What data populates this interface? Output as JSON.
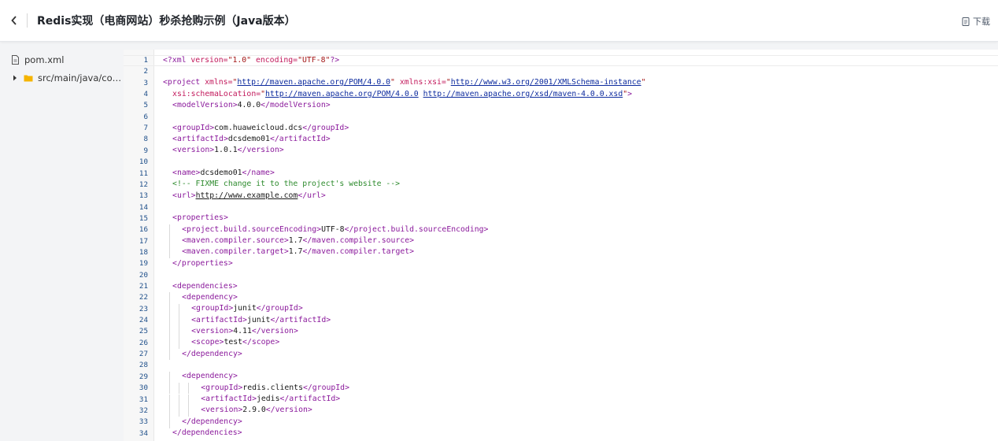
{
  "header": {
    "title": "Redis实现（电商网站）秒杀抢购示例（Java版本）",
    "download_label": "下载"
  },
  "sidebar": {
    "items": [
      {
        "label": "pom.xml",
        "icon": "file-icon"
      },
      {
        "label": "src/main/java/co…",
        "icon": "folder-icon"
      }
    ]
  },
  "colors": {
    "tag": "#8b1a9c",
    "attr_name": "#c2185b",
    "attr_value": "#a31515",
    "link": "#0d2b9e",
    "comment": "#2e8b2e",
    "line_number": "#1d4e89",
    "folder": "#f5b400"
  },
  "editor": {
    "lines": [
      {
        "n": "1",
        "indent": 0,
        "parts": [
          [
            "br",
            "<?"
          ],
          [
            "tg",
            "xml "
          ],
          [
            "an",
            "version="
          ],
          [
            "av",
            "\"1.0\""
          ],
          [
            "tx",
            " "
          ],
          [
            "an",
            "encoding="
          ],
          [
            "av",
            "\"UTF-8\""
          ],
          [
            "br",
            "?>"
          ]
        ]
      },
      {
        "n": "2",
        "indent": 0,
        "parts": []
      },
      {
        "n": "3",
        "indent": 0,
        "parts": [
          [
            "br",
            "<"
          ],
          [
            "tg",
            "project "
          ],
          [
            "an",
            "xmlns="
          ],
          [
            "av",
            "\""
          ],
          [
            "lnk",
            "http://maven.apache.org/POM/4.0.0"
          ],
          [
            "av",
            "\""
          ],
          [
            "tx",
            " "
          ],
          [
            "an",
            "xmlns:xsi="
          ],
          [
            "av",
            "\""
          ],
          [
            "lnk",
            "http://www.w3.org/2001/XMLSchema-instance"
          ],
          [
            "av",
            "\""
          ]
        ]
      },
      {
        "n": "4",
        "indent": 1,
        "parts": [
          [
            "an",
            "xsi:schemaLocation="
          ],
          [
            "av",
            "\""
          ],
          [
            "lnk",
            "http://maven.apache.org/POM/4.0.0"
          ],
          [
            "tx",
            " "
          ],
          [
            "lnk",
            "http://maven.apache.org/xsd/maven-4.0.0.xsd"
          ],
          [
            "av",
            "\""
          ],
          [
            "br",
            ">"
          ]
        ]
      },
      {
        "n": "5",
        "indent": 1,
        "parts": [
          [
            "br",
            "<"
          ],
          [
            "tg",
            "modelVersion"
          ],
          [
            "br",
            ">"
          ],
          [
            "tx",
            "4.0.0"
          ],
          [
            "br",
            "</"
          ],
          [
            "tg",
            "modelVersion"
          ],
          [
            "br",
            ">"
          ]
        ]
      },
      {
        "n": "6",
        "indent": 0,
        "parts": []
      },
      {
        "n": "7",
        "indent": 1,
        "parts": [
          [
            "br",
            "<"
          ],
          [
            "tg",
            "groupId"
          ],
          [
            "br",
            ">"
          ],
          [
            "tx",
            "com.huaweicloud.dcs"
          ],
          [
            "br",
            "</"
          ],
          [
            "tg",
            "groupId"
          ],
          [
            "br",
            ">"
          ]
        ]
      },
      {
        "n": "8",
        "indent": 1,
        "parts": [
          [
            "br",
            "<"
          ],
          [
            "tg",
            "artifactId"
          ],
          [
            "br",
            ">"
          ],
          [
            "tx",
            "dcsdemo01"
          ],
          [
            "br",
            "</"
          ],
          [
            "tg",
            "artifactId"
          ],
          [
            "br",
            ">"
          ]
        ]
      },
      {
        "n": "9",
        "indent": 1,
        "parts": [
          [
            "br",
            "<"
          ],
          [
            "tg",
            "version"
          ],
          [
            "br",
            ">"
          ],
          [
            "tx",
            "1.0.1"
          ],
          [
            "br",
            "</"
          ],
          [
            "tg",
            "version"
          ],
          [
            "br",
            ">"
          ]
        ]
      },
      {
        "n": "10",
        "indent": 0,
        "parts": []
      },
      {
        "n": "11",
        "indent": 1,
        "parts": [
          [
            "br",
            "<"
          ],
          [
            "tg",
            "name"
          ],
          [
            "br",
            ">"
          ],
          [
            "tx",
            "dcsdemo01"
          ],
          [
            "br",
            "</"
          ],
          [
            "tg",
            "name"
          ],
          [
            "br",
            ">"
          ]
        ]
      },
      {
        "n": "12",
        "indent": 1,
        "parts": [
          [
            "cm",
            "<!-- FIXME change it to the project's website -->"
          ]
        ]
      },
      {
        "n": "13",
        "indent": 1,
        "parts": [
          [
            "br",
            "<"
          ],
          [
            "tg",
            "url"
          ],
          [
            "br",
            ">"
          ],
          [
            "lnku",
            "http://www.example.com"
          ],
          [
            "br",
            "</"
          ],
          [
            "tg",
            "url"
          ],
          [
            "br",
            ">"
          ]
        ]
      },
      {
        "n": "14",
        "indent": 0,
        "parts": []
      },
      {
        "n": "15",
        "indent": 1,
        "parts": [
          [
            "br",
            "<"
          ],
          [
            "tg",
            "properties"
          ],
          [
            "br",
            ">"
          ]
        ]
      },
      {
        "n": "16",
        "indent": 2,
        "parts": [
          [
            "br",
            "<"
          ],
          [
            "tg",
            "project.build.sourceEncoding"
          ],
          [
            "br",
            ">"
          ],
          [
            "tx",
            "UTF-8"
          ],
          [
            "br",
            "</"
          ],
          [
            "tg",
            "project.build.sourceEncoding"
          ],
          [
            "br",
            ">"
          ]
        ]
      },
      {
        "n": "17",
        "indent": 2,
        "parts": [
          [
            "br",
            "<"
          ],
          [
            "tg",
            "maven.compiler.source"
          ],
          [
            "br",
            ">"
          ],
          [
            "tx",
            "1.7"
          ],
          [
            "br",
            "</"
          ],
          [
            "tg",
            "maven.compiler.source"
          ],
          [
            "br",
            ">"
          ]
        ]
      },
      {
        "n": "18",
        "indent": 2,
        "parts": [
          [
            "br",
            "<"
          ],
          [
            "tg",
            "maven.compiler.target"
          ],
          [
            "br",
            ">"
          ],
          [
            "tx",
            "1.7"
          ],
          [
            "br",
            "</"
          ],
          [
            "tg",
            "maven.compiler.target"
          ],
          [
            "br",
            ">"
          ]
        ]
      },
      {
        "n": "19",
        "indent": 1,
        "parts": [
          [
            "br",
            "</"
          ],
          [
            "tg",
            "properties"
          ],
          [
            "br",
            ">"
          ]
        ]
      },
      {
        "n": "20",
        "indent": 0,
        "parts": []
      },
      {
        "n": "21",
        "indent": 1,
        "parts": [
          [
            "br",
            "<"
          ],
          [
            "tg",
            "dependencies"
          ],
          [
            "br",
            ">"
          ]
        ]
      },
      {
        "n": "22",
        "indent": 2,
        "parts": [
          [
            "br",
            "<"
          ],
          [
            "tg",
            "dependency"
          ],
          [
            "br",
            ">"
          ]
        ]
      },
      {
        "n": "23",
        "indent": 3,
        "parts": [
          [
            "br",
            "<"
          ],
          [
            "tg",
            "groupId"
          ],
          [
            "br",
            ">"
          ],
          [
            "tx",
            "junit"
          ],
          [
            "br",
            "</"
          ],
          [
            "tg",
            "groupId"
          ],
          [
            "br",
            ">"
          ]
        ]
      },
      {
        "n": "24",
        "indent": 3,
        "parts": [
          [
            "br",
            "<"
          ],
          [
            "tg",
            "artifactId"
          ],
          [
            "br",
            ">"
          ],
          [
            "tx",
            "junit"
          ],
          [
            "br",
            "</"
          ],
          [
            "tg",
            "artifactId"
          ],
          [
            "br",
            ">"
          ]
        ]
      },
      {
        "n": "25",
        "indent": 3,
        "parts": [
          [
            "br",
            "<"
          ],
          [
            "tg",
            "version"
          ],
          [
            "br",
            ">"
          ],
          [
            "tx",
            "4.11"
          ],
          [
            "br",
            "</"
          ],
          [
            "tg",
            "version"
          ],
          [
            "br",
            ">"
          ]
        ]
      },
      {
        "n": "26",
        "indent": 3,
        "parts": [
          [
            "br",
            "<"
          ],
          [
            "tg",
            "scope"
          ],
          [
            "br",
            ">"
          ],
          [
            "tx",
            "test"
          ],
          [
            "br",
            "</"
          ],
          [
            "tg",
            "scope"
          ],
          [
            "br",
            ">"
          ]
        ]
      },
      {
        "n": "27",
        "indent": 2,
        "parts": [
          [
            "br",
            "</"
          ],
          [
            "tg",
            "dependency"
          ],
          [
            "br",
            ">"
          ]
        ]
      },
      {
        "n": "28",
        "indent": 0,
        "parts": []
      },
      {
        "n": "29",
        "indent": 2,
        "parts": [
          [
            "br",
            "<"
          ],
          [
            "tg",
            "dependency"
          ],
          [
            "br",
            ">"
          ]
        ]
      },
      {
        "n": "30",
        "indent": 4,
        "parts": [
          [
            "br",
            "<"
          ],
          [
            "tg",
            "groupId"
          ],
          [
            "br",
            ">"
          ],
          [
            "tx",
            "redis.clients"
          ],
          [
            "br",
            "</"
          ],
          [
            "tg",
            "groupId"
          ],
          [
            "br",
            ">"
          ]
        ]
      },
      {
        "n": "31",
        "indent": 4,
        "parts": [
          [
            "br",
            "<"
          ],
          [
            "tg",
            "artifactId"
          ],
          [
            "br",
            ">"
          ],
          [
            "tx",
            "jedis"
          ],
          [
            "br",
            "</"
          ],
          [
            "tg",
            "artifactId"
          ],
          [
            "br",
            ">"
          ]
        ]
      },
      {
        "n": "32",
        "indent": 4,
        "parts": [
          [
            "br",
            "<"
          ],
          [
            "tg",
            "version"
          ],
          [
            "br",
            ">"
          ],
          [
            "tx",
            "2.9.0"
          ],
          [
            "br",
            "</"
          ],
          [
            "tg",
            "version"
          ],
          [
            "br",
            ">"
          ]
        ]
      },
      {
        "n": "33",
        "indent": 2,
        "parts": [
          [
            "br",
            "</"
          ],
          [
            "tg",
            "dependency"
          ],
          [
            "br",
            ">"
          ]
        ]
      },
      {
        "n": "34",
        "indent": 1,
        "parts": [
          [
            "br",
            "</"
          ],
          [
            "tg",
            "dependencies"
          ],
          [
            "br",
            ">"
          ]
        ]
      }
    ]
  }
}
